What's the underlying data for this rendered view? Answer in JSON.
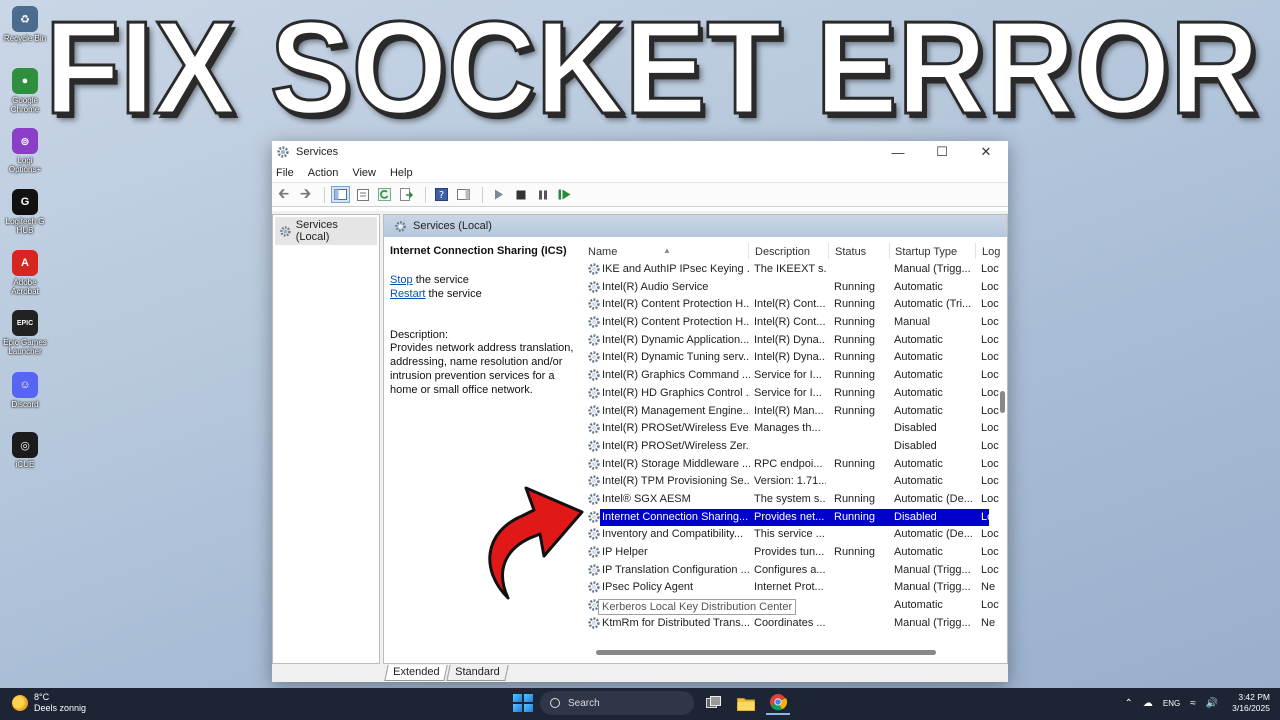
{
  "headline": "FIX SOCKET ERROR",
  "desktop": {
    "icons": [
      {
        "label": "Recycle Bin",
        "name": "recycle-bin-icon",
        "glyph": "♻",
        "color": "#4b6c8f"
      },
      {
        "label": "Google Chrome",
        "name": "chrome-icon",
        "glyph": "●",
        "color": "#2f8f3e"
      },
      {
        "label": "Logi Options+",
        "name": "logi-options-icon",
        "glyph": "⊚",
        "color": "#8b3ec7"
      },
      {
        "label": "Logitech G HUB",
        "name": "logitech-g-hub-icon",
        "glyph": "G",
        "color": "#111111"
      },
      {
        "label": "Adobe Acrobat",
        "name": "adobe-acrobat-icon",
        "glyph": "A",
        "color": "#d7261f"
      },
      {
        "label": "Epic Games Launcher",
        "name": "epic-games-icon",
        "glyph": "EPIC",
        "color": "#222222"
      },
      {
        "label": "Discord",
        "name": "discord-icon",
        "glyph": "☺",
        "color": "#5865f2"
      },
      {
        "label": "iCUE",
        "name": "icue-icon",
        "glyph": "◎",
        "color": "#1b1b1b"
      }
    ]
  },
  "window": {
    "title": "Services",
    "menu": [
      "File",
      "Action",
      "View",
      "Help"
    ],
    "tree_item": "Services (Local)",
    "pane_header": "Services (Local)",
    "detail": {
      "service_title": "Internet Connection Sharing (ICS)",
      "stop_link": "Stop",
      "stop_rest": " the service",
      "restart_link": "Restart",
      "restart_rest": " the service",
      "description_label": "Description:",
      "description": "Provides network address translation, addressing, name resolution and/or intrusion prevention services for a home or small office network."
    },
    "columns": {
      "name": "Name",
      "description": "Description",
      "status": "Status",
      "startup": "Startup Type",
      "logon": "Log"
    },
    "rows": [
      {
        "name": "IKE and AuthIP IPsec Keying ...",
        "desc": "The IKEEXT s...",
        "status": "",
        "startup": "Manual (Trigg...",
        "logon": "Loc"
      },
      {
        "name": "Intel(R) Audio Service",
        "desc": "",
        "status": "Running",
        "startup": "Automatic",
        "logon": "Loc"
      },
      {
        "name": "Intel(R) Content Protection H...",
        "desc": "Intel(R) Cont...",
        "status": "Running",
        "startup": "Automatic (Tri...",
        "logon": "Loc"
      },
      {
        "name": "Intel(R) Content Protection H...",
        "desc": "Intel(R) Cont...",
        "status": "Running",
        "startup": "Manual",
        "logon": "Loc"
      },
      {
        "name": "Intel(R) Dynamic Application...",
        "desc": "Intel(R) Dyna...",
        "status": "Running",
        "startup": "Automatic",
        "logon": "Loc"
      },
      {
        "name": "Intel(R) Dynamic Tuning serv...",
        "desc": "Intel(R) Dyna...",
        "status": "Running",
        "startup": "Automatic",
        "logon": "Loc"
      },
      {
        "name": "Intel(R) Graphics Command ...",
        "desc": "Service for I...",
        "status": "Running",
        "startup": "Automatic",
        "logon": "Loc"
      },
      {
        "name": "Intel(R) HD Graphics Control ...",
        "desc": "Service for I...",
        "status": "Running",
        "startup": "Automatic",
        "logon": "Loc"
      },
      {
        "name": "Intel(R) Management Engine...",
        "desc": "Intel(R) Man...",
        "status": "Running",
        "startup": "Automatic",
        "logon": "Loc"
      },
      {
        "name": "Intel(R) PROSet/Wireless Eve...",
        "desc": "Manages th...",
        "status": "",
        "startup": "Disabled",
        "logon": "Loc"
      },
      {
        "name": "Intel(R) PROSet/Wireless Zer...",
        "desc": "",
        "status": "",
        "startup": "Disabled",
        "logon": "Loc"
      },
      {
        "name": "Intel(R) Storage Middleware ...",
        "desc": "RPC endpoi...",
        "status": "Running",
        "startup": "Automatic",
        "logon": "Loc"
      },
      {
        "name": "Intel(R) TPM Provisioning Se...",
        "desc": "Version: 1.71...",
        "status": "",
        "startup": "Automatic",
        "logon": "Loc"
      },
      {
        "name": "Intel® SGX AESM",
        "desc": "The system s...",
        "status": "Running",
        "startup": "Automatic (De...",
        "logon": "Loc"
      },
      {
        "name": "Internet Connection Sharing...",
        "desc": "Provides net...",
        "status": "Running",
        "startup": "Disabled",
        "logon": "Loc",
        "selected": true
      },
      {
        "name": "Inventory and Compatibility...",
        "desc": "This service ...",
        "status": "",
        "startup": "Automatic (De...",
        "logon": "Loc"
      },
      {
        "name": "IP Helper",
        "desc": "Provides tun...",
        "status": "Running",
        "startup": "Automatic",
        "logon": "Loc"
      },
      {
        "name": "IP Translation Configuration ...",
        "desc": "Configures a...",
        "status": "",
        "startup": "Manual (Trigg...",
        "logon": "Loc"
      },
      {
        "name": "IPsec Policy Agent",
        "desc": "Internet Prot...",
        "status": "",
        "startup": "Manual (Trigg...",
        "logon": "Ne"
      },
      {
        "name": "",
        "desc": "vice ...",
        "status": "",
        "startup": "Automatic",
        "logon": "Loc",
        "tooltip": "Kerberos Local Key Distribution Center"
      },
      {
        "name": "KtmRm for Distributed Trans...",
        "desc": "Coordinates ...",
        "status": "",
        "startup": "Manual (Trigg...",
        "logon": "Ne"
      }
    ],
    "tabs": [
      "Extended",
      "Standard"
    ]
  },
  "taskbar": {
    "temperature": "8°C",
    "weather": "Deels zonnig",
    "search_label": "Search",
    "language": "ENG",
    "time": "3:42 PM",
    "date": "3/16/2025"
  },
  "colors": {
    "selection": "#0000cc",
    "link": "#0b4fa8",
    "arrow": "#e01818"
  }
}
